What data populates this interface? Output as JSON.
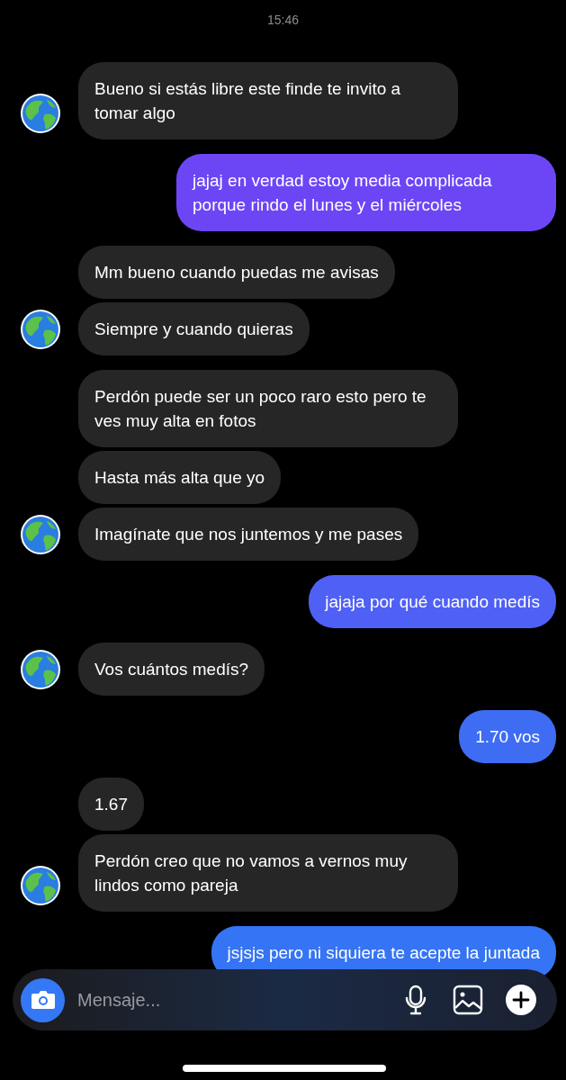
{
  "timestamp": "15:46",
  "groups": [
    {
      "kind": "incoming",
      "messages": [
        "Bueno si estás libre este finde te invito a tomar algo"
      ]
    },
    {
      "kind": "outgoing",
      "messages": [
        "jajaj en verdad estoy media complicada porque rindo el lunes y el miércoles"
      ]
    },
    {
      "kind": "incoming",
      "messages": [
        "Mm bueno cuando puedas me avisas",
        "Siempre y cuando quieras"
      ]
    },
    {
      "kind": "incoming",
      "messages": [
        "Perdón puede ser un poco raro esto pero te ves muy alta en fotos",
        "Hasta más alta que yo",
        "Imagínate que nos juntemos y me pases"
      ]
    },
    {
      "kind": "outgoing",
      "messages": [
        "jajaja por qué cuando medís"
      ]
    },
    {
      "kind": "incoming",
      "messages": [
        "Vos cuántos medís?"
      ]
    },
    {
      "kind": "outgoing",
      "messages": [
        "1.70 vos"
      ]
    },
    {
      "kind": "incoming",
      "messages": [
        "1.67",
        "Perdón creo que no vamos a vernos muy lindos como pareja"
      ]
    },
    {
      "kind": "outgoing",
      "messages": [
        "jsjsjs pero ni siquiera te acepte la juntada"
      ]
    }
  ],
  "composer": {
    "placeholder": "Mensaje..."
  }
}
